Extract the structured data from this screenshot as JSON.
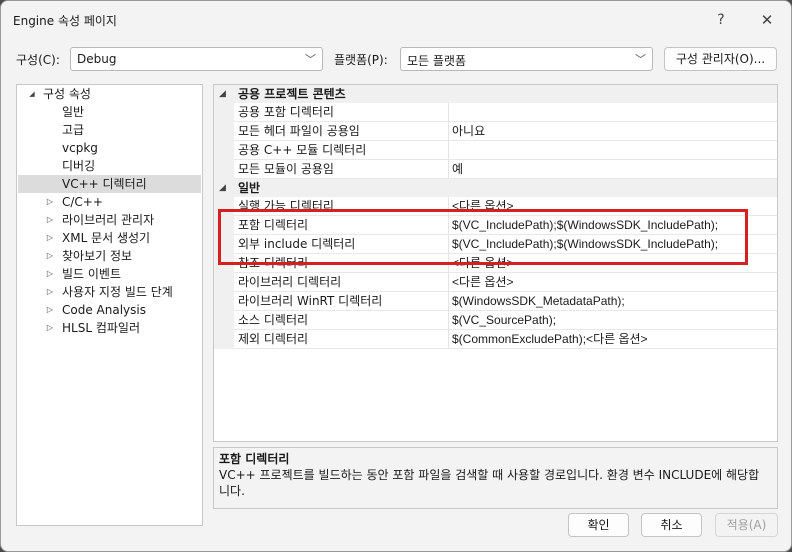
{
  "window": {
    "title": "Engine 속성 페이지",
    "help_icon": "?",
    "close_icon": "✕"
  },
  "toolbar": {
    "config_label": "구성(C):",
    "config_value": "Debug",
    "platform_label": "플랫폼(P):",
    "platform_value": "모든 플랫폼",
    "config_manager_label": "구성 관리자(O)..."
  },
  "tree": {
    "root": {
      "label": "구성 속성",
      "expander": "◢"
    },
    "items": [
      {
        "label": "일반",
        "expander": ""
      },
      {
        "label": "고급",
        "expander": ""
      },
      {
        "label": "vcpkg",
        "expander": ""
      },
      {
        "label": "디버깅",
        "expander": ""
      },
      {
        "label": "VC++ 디렉터리",
        "expander": "",
        "selected": true
      },
      {
        "label": "C/C++",
        "expander": "▷"
      },
      {
        "label": "라이브러리 관리자",
        "expander": "▷"
      },
      {
        "label": "XML 문서 생성기",
        "expander": "▷"
      },
      {
        "label": "찾아보기 정보",
        "expander": "▷"
      },
      {
        "label": "빌드 이벤트",
        "expander": "▷"
      },
      {
        "label": "사용자 지정 빌드 단계",
        "expander": "▷"
      },
      {
        "label": "Code Analysis",
        "expander": "▷"
      },
      {
        "label": "HLSL 컴파일러",
        "expander": "▷"
      }
    ]
  },
  "grid": {
    "categories": [
      {
        "label": "공용 프로젝트 콘텐츠",
        "expander": "◢",
        "properties": [
          {
            "name": "공용 포함 디렉터리",
            "value": ""
          },
          {
            "name": "모든 헤더 파일이 공용임",
            "value": "아니요"
          },
          {
            "name": "공용 C++ 모듈 디렉터리",
            "value": ""
          },
          {
            "name": "모든 모듈이 공용임",
            "value": "예"
          }
        ]
      },
      {
        "label": "일반",
        "expander": "◢",
        "properties": [
          {
            "name": "실행 가능 디렉터리",
            "value": "<다른 옵션>"
          },
          {
            "name": "포함 디렉터리",
            "value": "$(VC_IncludePath);$(WindowsSDK_IncludePath);"
          },
          {
            "name": "외부 include 디렉터리",
            "value": "$(VC_IncludePath);$(WindowsSDK_IncludePath);"
          },
          {
            "name": "참조 디렉터리",
            "value": "<다른 옵션>"
          },
          {
            "name": "라이브러리 디렉터리",
            "value": "<다른 옵션>"
          },
          {
            "name": "라이브러리 WinRT 디렉터리",
            "value": "$(WindowsSDK_MetadataPath);"
          },
          {
            "name": "소스 디렉터리",
            "value": "$(VC_SourcePath);"
          },
          {
            "name": "제외 디렉터리",
            "value": "$(CommonExcludePath);<다른 옵션>"
          }
        ]
      }
    ]
  },
  "description": {
    "title": "포함 디렉터리",
    "text": "VC++ 프로젝트를 빌드하는 동안 포함 파일을 검색할 때 사용할 경로입니다.  환경 변수 INCLUDE에 해당합니다."
  },
  "footer": {
    "ok_label": "확인",
    "cancel_label": "취소",
    "apply_label": "적용(A)"
  },
  "colors": {
    "highlight_border": "#d42020",
    "selected_row": "#dcdcdc"
  }
}
